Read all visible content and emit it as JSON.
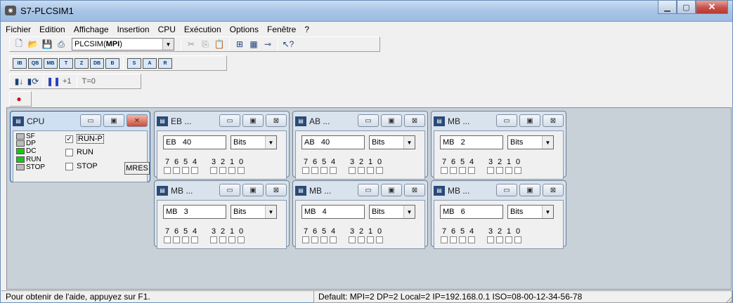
{
  "window": {
    "title": "S7-PLCSIM1",
    "icon": "plcsim-app-icon"
  },
  "menu": [
    "Fichier",
    "Edition",
    "Affichage",
    "Insertion",
    "CPU",
    "Exécution",
    "Options",
    "Fenêtre",
    "?"
  ],
  "toolbar": {
    "interface_prefix": "PLCSIM(",
    "interface_bold": "MPI",
    "interface_suffix": ")",
    "step_label": "+1",
    "timer_label": "T=0"
  },
  "cpu": {
    "title": "CPU",
    "leds": [
      {
        "label": "SF",
        "state": "off"
      },
      {
        "label": "DP",
        "state": "off"
      },
      {
        "label": "DC",
        "state": "on"
      },
      {
        "label": "RUN",
        "state": "on"
      },
      {
        "label": "STOP",
        "state": "off"
      }
    ],
    "modes": [
      {
        "label": "RUN-P",
        "checked": true
      },
      {
        "label": "RUN",
        "checked": false
      },
      {
        "label": "STOP",
        "checked": false
      }
    ],
    "mres_label": "MRES",
    "colors": {
      "led_on": "#16c814",
      "led_off": "#bbbbbb"
    }
  },
  "windows": [
    {
      "title": "EB ...",
      "area": "EB",
      "address": "40",
      "format": "Bits",
      "bits": [
        "7",
        "6",
        "5",
        "4",
        "3",
        "2",
        "1",
        "0"
      ]
    },
    {
      "title": "AB ...",
      "area": "AB",
      "address": "40",
      "format": "Bits",
      "bits": [
        "7",
        "6",
        "5",
        "4",
        "3",
        "2",
        "1",
        "0"
      ]
    },
    {
      "title": "MB ...",
      "area": "MB",
      "address": "2",
      "format": "Bits",
      "bits": [
        "7",
        "6",
        "5",
        "4",
        "3",
        "2",
        "1",
        "0"
      ]
    },
    {
      "title": "MB ...",
      "area": "MB",
      "address": "3",
      "format": "Bits",
      "bits": [
        "7",
        "6",
        "5",
        "4",
        "3",
        "2",
        "1",
        "0"
      ]
    },
    {
      "title": "MB ...",
      "area": "MB",
      "address": "4",
      "format": "Bits",
      "bits": [
        "7",
        "6",
        "5",
        "4",
        "3",
        "2",
        "1",
        "0"
      ]
    },
    {
      "title": "MB ...",
      "area": "MB",
      "address": "6",
      "format": "Bits",
      "bits": [
        "7",
        "6",
        "5",
        "4",
        "3",
        "2",
        "1",
        "0"
      ]
    }
  ],
  "status": {
    "help": "Pour obtenir de l'aide, appuyez sur F1.",
    "connection": "Default:  MPI=2 DP=2 Local=2 IP=192.168.0.1 ISO=08-00-12-34-56-78"
  }
}
